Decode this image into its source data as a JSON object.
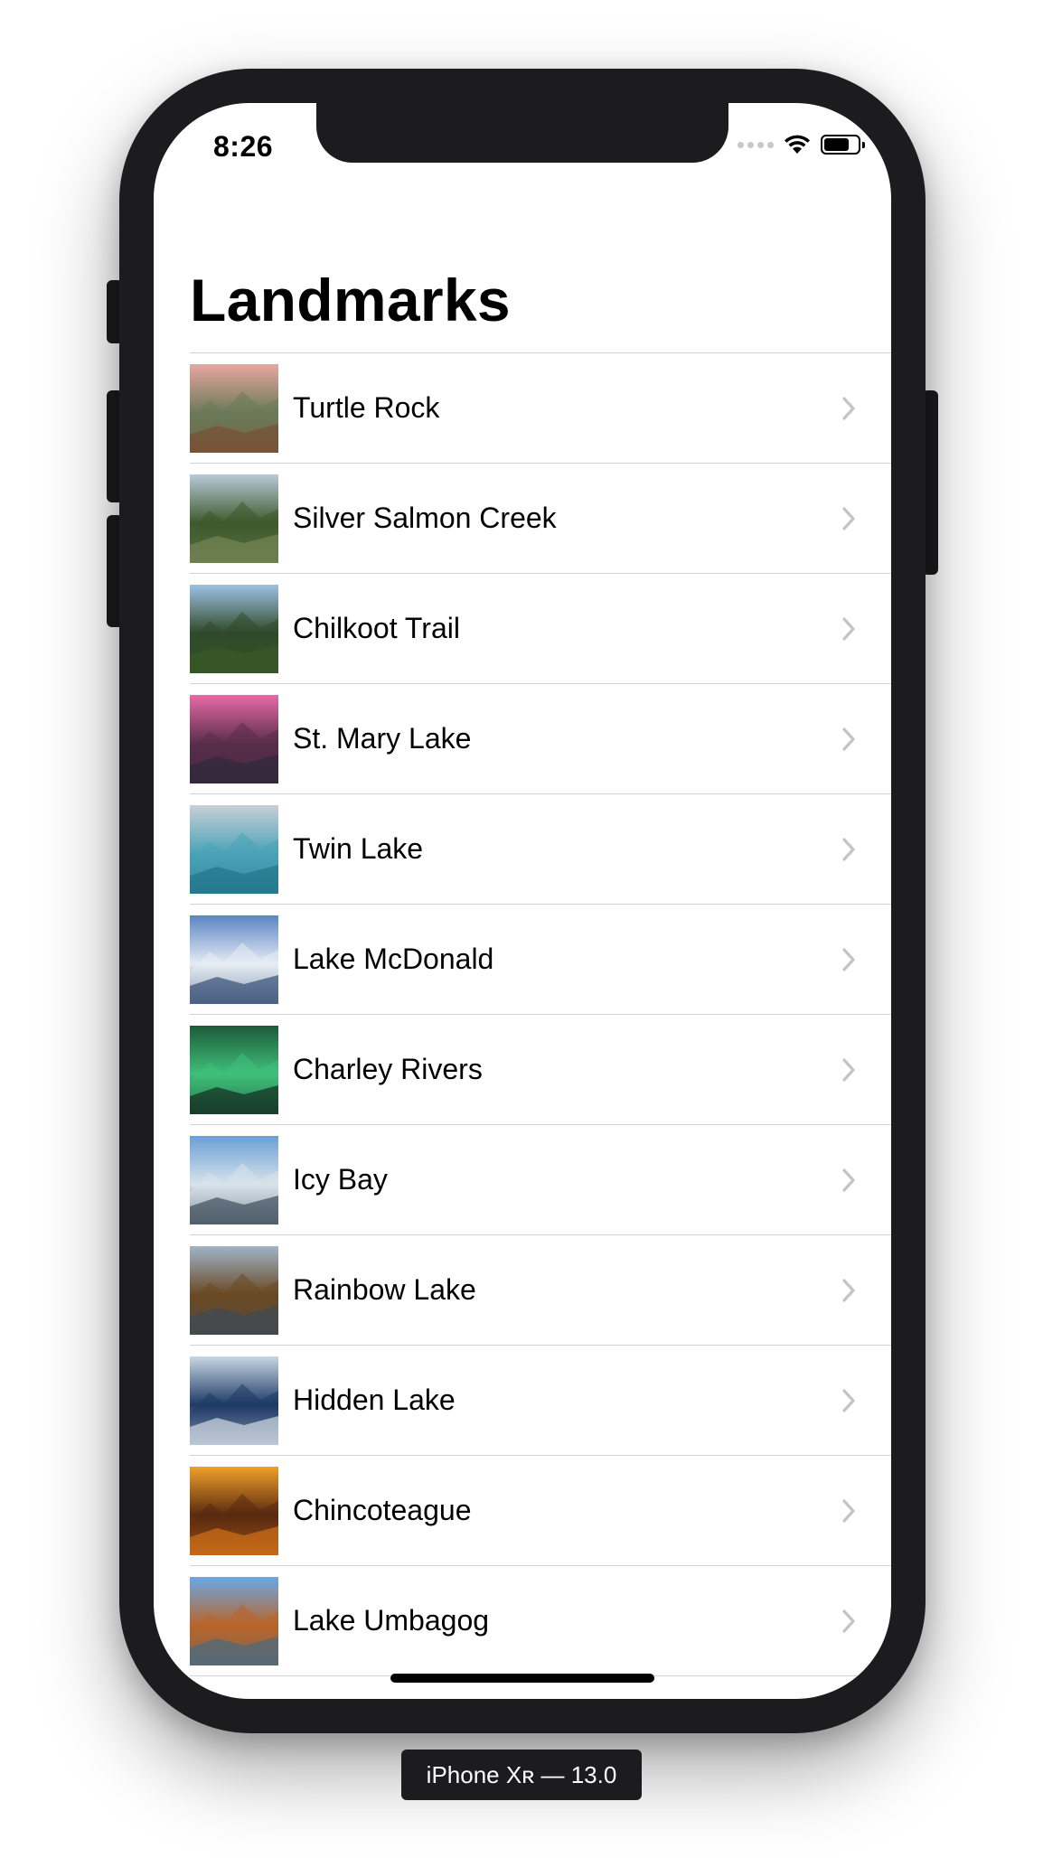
{
  "status_bar": {
    "time": "8:26",
    "icons": [
      "cellular-signal-icon",
      "wifi-icon",
      "battery-icon"
    ],
    "battery_level": 0.75
  },
  "nav": {
    "title": "Landmarks"
  },
  "landmarks": [
    {
      "name": "Turtle Rock",
      "thumb_colors": [
        "#e7a7a0",
        "#6b7a5a",
        "#7a4a2e"
      ]
    },
    {
      "name": "Silver Salmon Creek",
      "thumb_colors": [
        "#b9c9d8",
        "#3e5a2c",
        "#7b8a5a"
      ]
    },
    {
      "name": "Chilkoot Trail",
      "thumb_colors": [
        "#9ec1e4",
        "#2f4a2a",
        "#3a5a24"
      ]
    },
    {
      "name": "St. Mary Lake",
      "thumb_colors": [
        "#e86aa8",
        "#5a2e4a",
        "#2a2838"
      ]
    },
    {
      "name": "Twin Lake",
      "thumb_colors": [
        "#c8cfd6",
        "#4aa3b8",
        "#1d6f86"
      ]
    },
    {
      "name": "Lake McDonald",
      "thumb_colors": [
        "#5a84c4",
        "#e6ecf4",
        "#203a66"
      ]
    },
    {
      "name": "Charley Rivers",
      "thumb_colors": [
        "#1e5a3a",
        "#3fc07a",
        "#0d1a14"
      ]
    },
    {
      "name": "Icy Bay",
      "thumb_colors": [
        "#6a9fd6",
        "#d8e2ea",
        "#2c3a4a"
      ]
    },
    {
      "name": "Rainbow Lake",
      "thumb_colors": [
        "#9fb4c8",
        "#6a4a24",
        "#3a4a5a"
      ]
    },
    {
      "name": "Hidden Lake",
      "thumb_colors": [
        "#c9d6e4",
        "#1e3a66",
        "#e8eef4"
      ]
    },
    {
      "name": "Chincoteague",
      "thumb_colors": [
        "#f0a02a",
        "#5a2a10",
        "#e07a1a"
      ]
    },
    {
      "name": "Lake Umbagog",
      "thumb_colors": [
        "#6aa8e6",
        "#b8652a",
        "#3a6a8a"
      ]
    }
  ],
  "device": {
    "caption": "iPhone Xʀ — 13.0"
  },
  "colors": {
    "separator": "#d1d1d6",
    "chevron": "#c4c4c7",
    "frame": "#1c1c1e"
  }
}
